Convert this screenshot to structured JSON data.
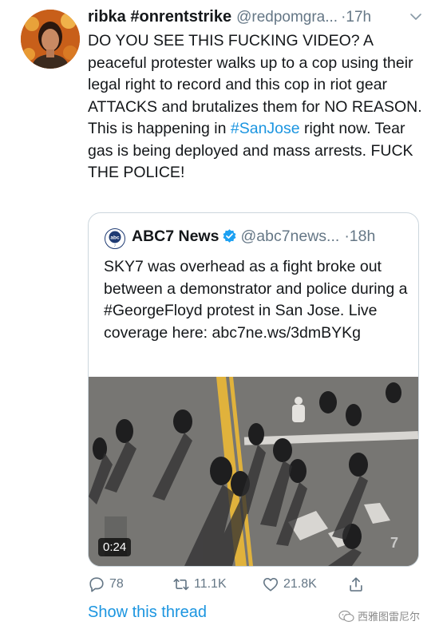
{
  "tweet": {
    "display_name": "ribka #onrentstrike",
    "handle": "@redpomgra...",
    "time": "·17h",
    "text_part1": "DO YOU SEE THIS FUCKING VIDEO? A peaceful protester walks up to a cop using their legal right to record and this cop in riot gear ATTACKS and brutalizes them for NO REASON. This is happening in ",
    "hashtag": "#SanJose",
    "text_part2": " right now. Tear gas is being deployed and mass arrests. FUCK THE POLICE!"
  },
  "quoted_tweet": {
    "display_name": "ABC7 News",
    "handle": "@abc7news...",
    "time": "·18h",
    "text": "SKY7 was overhead as a fight broke out between a demonstrator and police during a #GeorgeFloyd protest in San Jose. Live coverage here: abc7ne.ws/3dmBYKg",
    "video_duration": "0:24"
  },
  "actions": {
    "replies": "78",
    "retweets": "11.1K",
    "likes": "21.8K"
  },
  "show_thread_label": "Show this thread",
  "watermark_text": "西雅图雷尼尔",
  "colors": {
    "link": "#1b95e0",
    "secondary_text": "#657786",
    "border": "#ccd6dd",
    "verified": "#1da1f2"
  },
  "icons": [
    "avatar",
    "chevron-down-icon",
    "abc7-logo",
    "verified-badge-icon",
    "reply-icon",
    "retweet-icon",
    "like-icon",
    "share-icon",
    "wechat-icon"
  ]
}
